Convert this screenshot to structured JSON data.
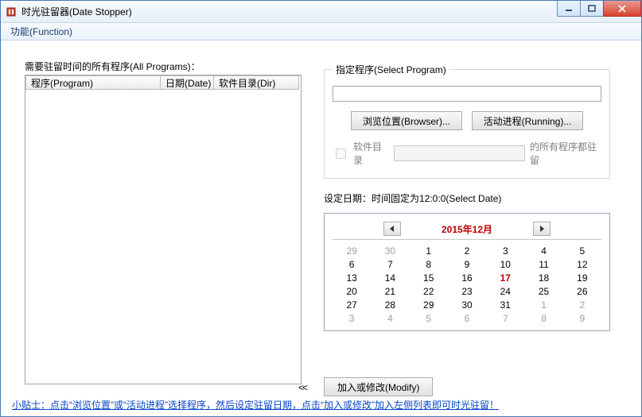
{
  "window": {
    "title": "时光驻留器(Date Stopper)"
  },
  "menu": {
    "functions": "功能(Function)"
  },
  "win_controls": {
    "min": "–",
    "max": "□",
    "close": "×"
  },
  "left": {
    "caption": "需要驻留时间的所有程序(All Programs)：",
    "columns": {
      "program": "程序(Program)",
      "date": "日期(Date)",
      "dir": "软件目录(Dir)"
    }
  },
  "select_program": {
    "legend": "指定程序(Select Program)",
    "path": "",
    "browser_btn": "浏览位置(Browser)...",
    "running_btn": "活动进程(Running)...",
    "dir_checkbox_label": "软件目录",
    "dir_input": "",
    "dir_suffix": "的所有程序都驻留"
  },
  "date_section": {
    "caption": "设定日期：时间固定为12:0:0(Select Date)"
  },
  "calendar": {
    "title": "2015年12月",
    "today": 17,
    "grid": [
      {
        "n": 29,
        "other": true
      },
      {
        "n": 30,
        "other": true
      },
      {
        "n": 1
      },
      {
        "n": 2
      },
      {
        "n": 3
      },
      {
        "n": 4
      },
      {
        "n": 5
      },
      {
        "n": 6
      },
      {
        "n": 7
      },
      {
        "n": 8
      },
      {
        "n": 9
      },
      {
        "n": 10
      },
      {
        "n": 11
      },
      {
        "n": 12
      },
      {
        "n": 13
      },
      {
        "n": 14
      },
      {
        "n": 15
      },
      {
        "n": 16
      },
      {
        "n": 17,
        "today": true
      },
      {
        "n": 18
      },
      {
        "n": 19
      },
      {
        "n": 20
      },
      {
        "n": 21
      },
      {
        "n": 22
      },
      {
        "n": 23
      },
      {
        "n": 24
      },
      {
        "n": 25
      },
      {
        "n": 26
      },
      {
        "n": 27
      },
      {
        "n": 28
      },
      {
        "n": 29
      },
      {
        "n": 30
      },
      {
        "n": 31
      },
      {
        "n": 1,
        "other": true
      },
      {
        "n": 2,
        "other": true
      },
      {
        "n": 3,
        "other": true
      },
      {
        "n": 4,
        "other": true
      },
      {
        "n": 5,
        "other": true
      },
      {
        "n": 6,
        "other": true
      },
      {
        "n": 7,
        "other": true
      },
      {
        "n": 8,
        "other": true
      },
      {
        "n": 9,
        "other": true
      }
    ]
  },
  "transfer_arrow": "<<",
  "modify_button": "加入或修改(Modify)",
  "tip_text": "小贴士：点击“浏览位置”或“活动进程”选择程序，然后设定驻留日期，点击“加入或修改”加入左侧列表即可时光驻留！"
}
